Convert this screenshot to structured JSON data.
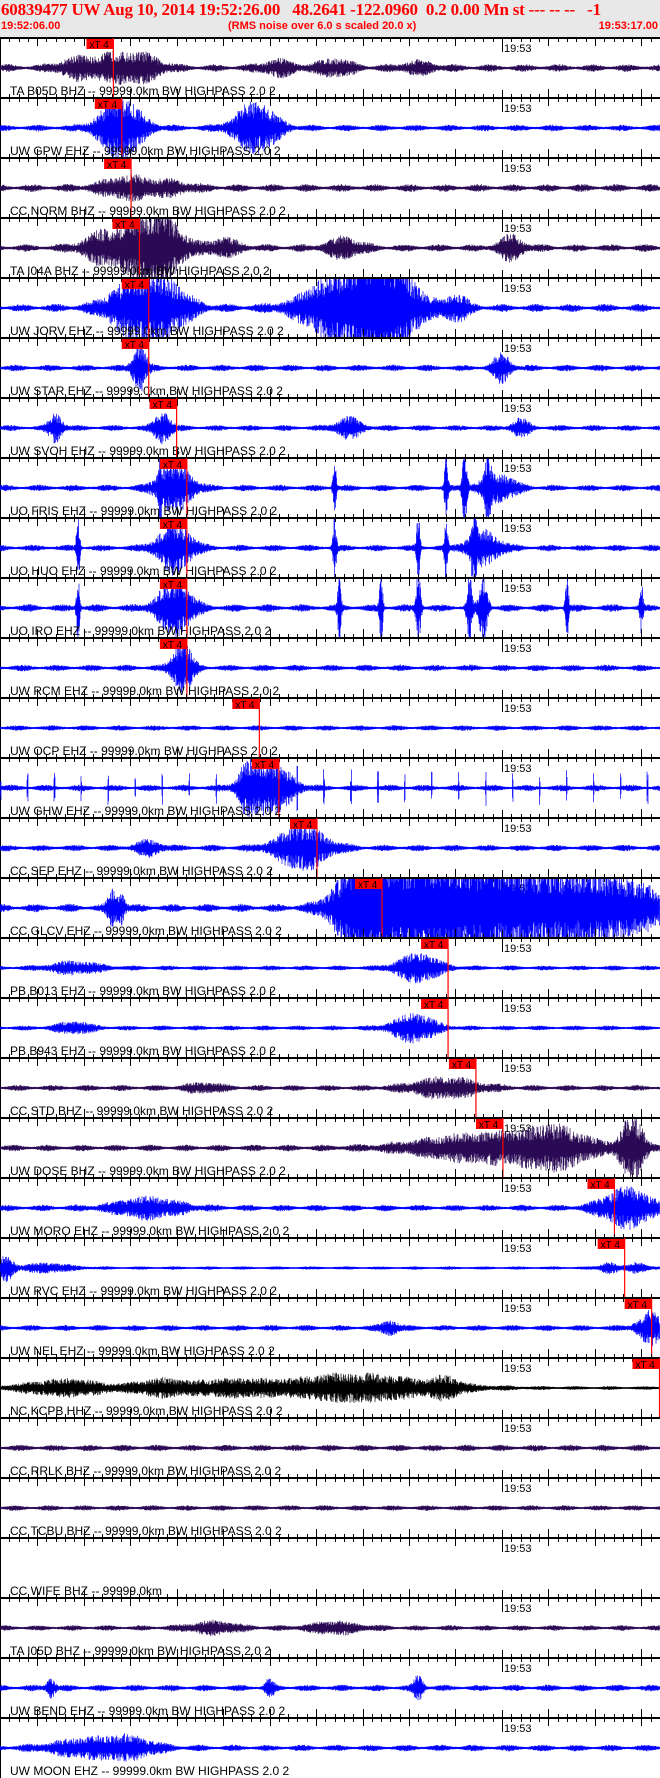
{
  "header": {
    "title": "60839477 UW Aug 10, 2014 19:52:26.00   48.2641 -122.0960  0.2 0.00 Mn st --- -- --   -1",
    "start_time": "19:52:06.00",
    "note": "(RMS noise over 6.0 s scaled 20.0 x)",
    "end_time": "19:53:17.00"
  },
  "chart_data": {
    "type": "seismogram",
    "time_window_s": [
      0,
      71
    ],
    "minute_tick_label": "19:53",
    "minute_tick_time_s": 54,
    "pick_label": "xT 4",
    "colors": {
      "EHZ": "#0000ff",
      "BHZ": "#2a0a55",
      "HHZ": "#000000",
      "pick": "#ff0000",
      "axis": "#000000"
    },
    "traces": [
      {
        "label": "TA B05D BHZ -- 99999.0km BW  HIGHPASS  2.0  2",
        "comp": "BHZ",
        "pick_s": 12.2,
        "noise": 0.12,
        "events": [
          [
            8,
            0.3,
            2
          ],
          [
            12.5,
            0.5,
            3
          ],
          [
            16,
            0.3,
            2
          ],
          [
            30,
            0.25,
            2
          ],
          [
            36,
            0.3,
            2
          ],
          [
            45,
            0.2,
            2
          ]
        ]
      },
      {
        "label": "UW GPW EHZ -- 99999.0km BW  HIGHPASS  2.0  2",
        "comp": "EHZ",
        "pick_s": 13.1,
        "noise": 0.1,
        "events": [
          [
            13,
            1.1,
            2.5
          ],
          [
            27.5,
            0.9,
            2.5
          ]
        ]
      },
      {
        "label": "CC NORM BHZ -- 99999.0km BW  HIGHPASS  2.0  2",
        "comp": "BHZ",
        "pick_s": 14.1,
        "noise": 0.12,
        "events": [
          [
            13.5,
            0.35,
            3
          ],
          [
            18,
            0.2,
            3
          ]
        ]
      },
      {
        "label": "TA I04A BHZ -- 99999.0km BW  HIGHPASS  2.0  2",
        "comp": "BHZ",
        "pick_s": 15.0,
        "noise": 0.12,
        "events": [
          [
            11,
            0.45,
            2.5
          ],
          [
            15,
            0.8,
            3
          ],
          [
            17.5,
            0.95,
            2.5
          ],
          [
            24,
            0.3,
            2
          ],
          [
            37,
            0.35,
            2
          ],
          [
            55,
            0.4,
            1.5
          ]
        ]
      },
      {
        "label": "UW JORV EHZ -- 99999.0km BW  HIGHPASS  2.0  2",
        "comp": "EHZ",
        "pick_s": 16.0,
        "noise": 0.13,
        "events": [
          [
            14,
            0.8,
            3
          ],
          [
            17.5,
            1.0,
            3
          ],
          [
            38,
            1.6,
            5
          ],
          [
            42,
            1.4,
            3
          ],
          [
            49,
            0.45,
            1.5
          ]
        ]
      },
      {
        "label": "UW STAR EHZ -- 99999.0km BW  HIGHPASS  2.0  2",
        "comp": "EHZ",
        "pick_s": 16.0,
        "noise": 0.1,
        "events": [
          [
            15,
            0.9,
            0.8
          ],
          [
            54,
            0.5,
            1
          ]
        ]
      },
      {
        "label": "UW SVOH EHZ -- 99999.0km BW  HIGHPASS  2.0  2",
        "comp": "EHZ",
        "pick_s": 19.0,
        "noise": 0.09,
        "events": [
          [
            6,
            0.5,
            0.8
          ],
          [
            17.5,
            0.55,
            1
          ],
          [
            37.5,
            0.35,
            1.5
          ],
          [
            56,
            0.3,
            1
          ]
        ]
      },
      {
        "label": "UO FRIS EHZ -- 99999.0km BW  HIGHPASS  2.0  2",
        "comp": "EHZ",
        "pick_s": 20.1,
        "noise": 0.1,
        "events": [
          [
            17.2,
            1.2,
            0.2
          ],
          [
            18.8,
            0.9,
            2
          ],
          [
            36,
            1.2,
            0.2
          ],
          [
            48,
            1.3,
            0.2
          ],
          [
            50,
            1.3,
            0.3
          ],
          [
            52.5,
            1.2,
            0.3
          ],
          [
            53.5,
            0.5,
            2
          ]
        ]
      },
      {
        "label": "UO HUO EHZ -- 99999.0km BW  HIGHPASS  2.0  2",
        "comp": "EHZ",
        "pick_s": 20.1,
        "noise": 0.1,
        "events": [
          [
            8.4,
            1.3,
            0.2
          ],
          [
            18.8,
            0.9,
            2
          ],
          [
            36,
            1.2,
            0.2
          ],
          [
            45,
            1.3,
            0.2
          ],
          [
            48,
            1.3,
            0.2
          ],
          [
            51,
            1.3,
            0.3
          ],
          [
            52,
            0.6,
            2
          ]
        ]
      },
      {
        "label": "UO IRO EHZ -- 99999.0km BW  HIGHPASS  2.0  2",
        "comp": "EHZ",
        "pick_s": 20.1,
        "noise": 0.12,
        "events": [
          [
            8.4,
            1.3,
            0.2
          ],
          [
            18.8,
            1.0,
            2
          ],
          [
            36.5,
            1.3,
            0.2
          ],
          [
            41,
            1.3,
            0.2
          ],
          [
            45,
            1.3,
            0.3
          ],
          [
            50.5,
            1.3,
            0.3
          ],
          [
            52,
            1.3,
            0.5
          ],
          [
            61,
            1.2,
            0.2
          ],
          [
            69,
            0.9,
            0.2
          ]
        ]
      },
      {
        "label": "UW RCM EHZ -- 99999.0km BW  HIGHPASS  2.0  2",
        "comp": "EHZ",
        "pick_s": 20.1,
        "noise": 0.1,
        "events": [
          [
            19.6,
            0.9,
            1.2
          ]
        ]
      },
      {
        "label": "UW OCP EHZ -- 99999.0km BW  HIGHPASS  2.0  2",
        "comp": "EHZ",
        "pick_s": 27.9,
        "noise": 0.08,
        "events": []
      },
      {
        "label": "UW GHW EHZ -- 99999.0km BW  HIGHPASS  2.0  2",
        "comp": "EHZ",
        "pick_s": 30.0,
        "noise": 0.1,
        "periodic_spike_s": 2.9,
        "events": [
          [
            26.5,
            0.6,
            1
          ],
          [
            29,
            1.0,
            2.5
          ]
        ]
      },
      {
        "label": "CC SEP EHZ -- 99999.0km BW  HIGHPASS  2.0  2",
        "comp": "EHZ",
        "pick_s": 34.1,
        "noise": 0.1,
        "events": [
          [
            16,
            0.25,
            1.5
          ],
          [
            32.5,
            0.8,
            3
          ]
        ]
      },
      {
        "label": "CC GLCV EHZ -- 99999.0km BW  HIGHPASS  2.0  2",
        "comp": "EHZ",
        "pick_s": 41.1,
        "noise": 0.13,
        "events": [
          [
            12,
            0.6,
            0.5
          ],
          [
            13,
            0.6,
            0.5
          ],
          [
            39,
            1.6,
            3
          ],
          [
            45,
            1.8,
            6
          ],
          [
            55,
            1.5,
            8
          ],
          [
            66,
            1.0,
            6
          ]
        ]
      },
      {
        "label": "PB B013 EHZ -- 99999.0km BW  HIGHPASS  2.0  2",
        "comp": "EHZ",
        "pick_s": 48.2,
        "noise": 0.07,
        "events": [
          [
            8,
            0.2,
            3
          ],
          [
            45,
            0.5,
            2.5
          ]
        ]
      },
      {
        "label": "PB B943 EHZ -- 99999.0km BW  HIGHPASS  2.0  2",
        "comp": "EHZ",
        "pick_s": 48.2,
        "noise": 0.07,
        "events": [
          [
            8,
            0.2,
            2
          ],
          [
            44.5,
            0.5,
            2.5
          ]
        ]
      },
      {
        "label": "CC STD BHZ -- 99999.0km BW  HIGHPASS  2.0  2",
        "comp": "BHZ",
        "pick_s": 51.2,
        "noise": 0.09,
        "events": [
          [
            22,
            0.15,
            2
          ],
          [
            48,
            0.35,
            4
          ]
        ]
      },
      {
        "label": "UW DOSE BHZ -- 99999.0km BW  HIGHPASS  2.0  2",
        "comp": "BHZ",
        "pick_s": 54.1,
        "noise": 0.1,
        "events": [
          [
            52,
            0.5,
            8
          ],
          [
            60,
            0.6,
            4
          ],
          [
            68,
            1.1,
            1.5
          ]
        ]
      },
      {
        "label": "UW MORO EHZ -- 99999.0km BW  HIGHPASS  2.0  2",
        "comp": "EHZ",
        "pick_s": 66.1,
        "noise": 0.1,
        "events": [
          [
            16,
            0.35,
            4
          ],
          [
            67.5,
            0.7,
            3
          ]
        ]
      },
      {
        "label": "UW RVC EHZ -- 99999.0km BW  HIGHPASS  2.0  2",
        "comp": "EHZ",
        "pick_s": 67.2,
        "noise": 0.04,
        "events": [
          [
            0.7,
            0.45,
            0.8
          ],
          [
            5,
            0.15,
            3
          ],
          [
            65.5,
            0.2,
            1
          ],
          [
            68.5,
            0.2,
            1
          ]
        ]
      },
      {
        "label": "UW NEL EHZ -- 99999.0km BW  HIGHPASS  2.0  2",
        "comp": "EHZ",
        "pick_s": 70.1,
        "noise": 0.09,
        "events": [
          [
            42,
            0.25,
            1
          ],
          [
            70,
            0.55,
            1.5
          ]
        ]
      },
      {
        "label": "NC KCPB HHZ -- 99999.0km BW  HIGHPASS  2.0  2",
        "comp": "HHZ",
        "pick_s": 71.0,
        "noise": 0.05,
        "events": [
          [
            7,
            0.3,
            5
          ],
          [
            17,
            0.25,
            3
          ],
          [
            25,
            0.3,
            6
          ],
          [
            36,
            0.3,
            6
          ],
          [
            42,
            0.3,
            8
          ],
          [
            48,
            0.25,
            1.5
          ]
        ]
      },
      {
        "label": "CC RRLK BHZ -- 99999.0km BW  HIGHPASS  2.0  2",
        "comp": "BHZ",
        "pick_s": null,
        "noise": 0.1,
        "events": []
      },
      {
        "label": "CC TCBU BHZ -- 99999.0km BW  HIGHPASS  2.0  2",
        "comp": "BHZ",
        "pick_s": null,
        "noise": 0.08,
        "events": []
      },
      {
        "label": "CC WIFE BHZ -- 99999.0km",
        "comp": "BHZ",
        "pick_s": null,
        "noise": 0,
        "events": [],
        "empty": true
      },
      {
        "label": "TA I05D BHZ -- 99999.0km BW  HIGHPASS  2.0  2",
        "comp": "BHZ",
        "pick_s": null,
        "noise": 0.08,
        "events": [
          [
            23,
            0.2,
            3
          ],
          [
            36,
            0.2,
            3
          ]
        ]
      },
      {
        "label": "UW BEND EHZ -- 99999.0km BW  HIGHPASS  2.0  2",
        "comp": "EHZ",
        "pick_s": null,
        "noise": 0.1,
        "events": [
          [
            5.5,
            0.35,
            0.5
          ],
          [
            29,
            0.3,
            0.5
          ],
          [
            45,
            0.4,
            0.6
          ]
        ]
      },
      {
        "label": "UW MOON EHZ -- 99999.0km BW  HIGHPASS  2.0  2",
        "comp": "EHZ",
        "pick_s": null,
        "noise": 0.1,
        "events": [
          [
            9,
            0.3,
            4
          ],
          [
            14,
            0.35,
            3
          ]
        ]
      }
    ]
  }
}
